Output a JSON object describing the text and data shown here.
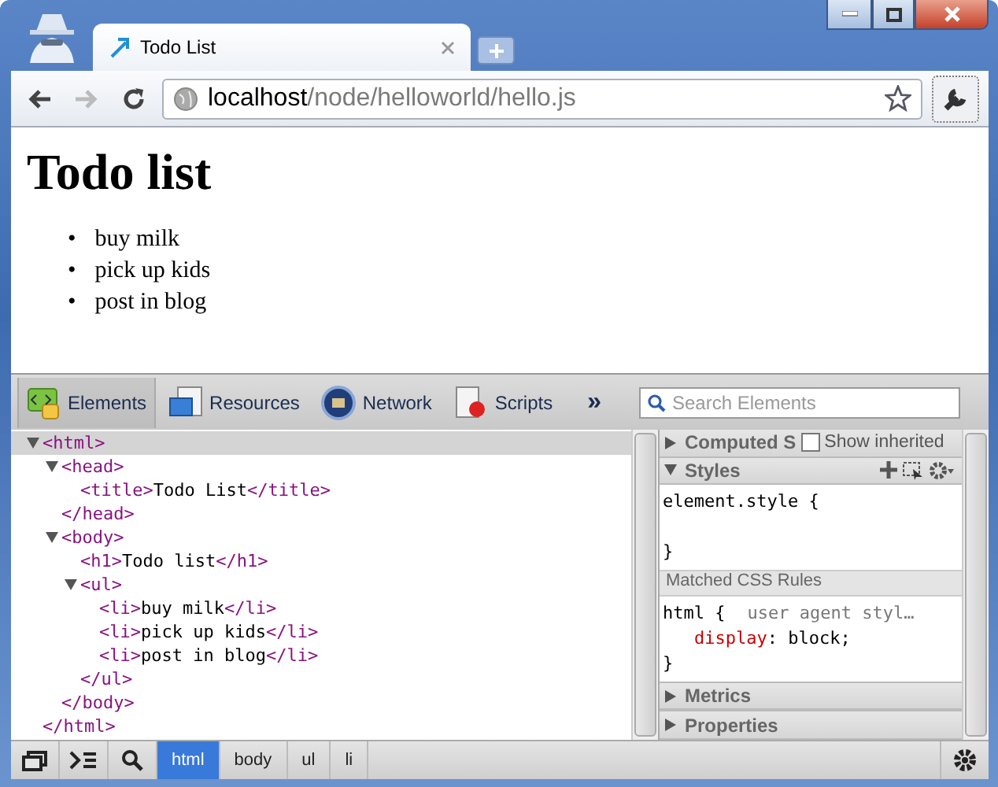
{
  "browser": {
    "tab": {
      "title": "Todo List"
    },
    "url": {
      "host": "localhost",
      "path": "/node/helloworld/hello.js"
    }
  },
  "page": {
    "heading": "Todo list",
    "items": [
      {
        "marker": "•",
        "text": "buy milk"
      },
      {
        "marker": "•",
        "text": "pick up kids"
      },
      {
        "marker": "•",
        "text": "post in blog"
      }
    ]
  },
  "devtools": {
    "panels": [
      {
        "label": "Elements",
        "selected": true
      },
      {
        "label": "Resources",
        "selected": false
      },
      {
        "label": "Network",
        "selected": false
      },
      {
        "label": "Scripts",
        "selected": false
      }
    ],
    "more": "»",
    "search": {
      "placeholder": "Search Elements"
    },
    "dom_tree": [
      {
        "open": "<html>",
        "close": "</html>",
        "expanded": true,
        "selected": true,
        "children": [
          {
            "open": "<head>",
            "close": "</head>",
            "expanded": true,
            "selected": false,
            "children": [
              {
                "open": "<title>",
                "text": "Todo List",
                "close": "</title>",
                "selected": false
              }
            ]
          },
          {
            "open": "<body>",
            "close": "</body>",
            "expanded": true,
            "selected": false,
            "children": [
              {
                "open": "<h1>",
                "text": "Todo list",
                "close": "</h1>",
                "selected": false
              },
              {
                "open": "<ul>",
                "close": "</ul>",
                "expanded": true,
                "selected": false,
                "children": [
                  {
                    "open": "<li>",
                    "text": "buy milk",
                    "close": "</li>",
                    "selected": false
                  },
                  {
                    "open": "<li>",
                    "text": "pick up kids",
                    "close": "</li>",
                    "selected": false
                  },
                  {
                    "open": "<li>",
                    "text": "post in blog",
                    "close": "</li>",
                    "selected": false
                  }
                ]
              }
            ]
          }
        ]
      }
    ],
    "sidebar": {
      "computed": {
        "title": "Computed S",
        "expanded": false,
        "show_inherited": {
          "label": "Show inherited",
          "checked": false
        }
      },
      "styles": {
        "title": "Styles",
        "expanded": true,
        "element_style": {
          "open": "element.style {",
          "close": "}"
        },
        "matched_title": "Matched CSS Rules",
        "rules": [
          {
            "selector": "html {",
            "source": "user agent styl…",
            "properties": [
              {
                "name": "display",
                "separator": ":",
                "value": "block;"
              }
            ],
            "close": "}"
          }
        ]
      },
      "sections": [
        {
          "title": "Metrics",
          "expanded": false
        },
        {
          "title": "Properties",
          "expanded": false
        }
      ]
    },
    "breadcrumbs": [
      {
        "label": "html",
        "selected": true
      },
      {
        "label": "body",
        "selected": false
      },
      {
        "label": "ul",
        "selected": false
      },
      {
        "label": "li",
        "selected": false
      }
    ]
  }
}
